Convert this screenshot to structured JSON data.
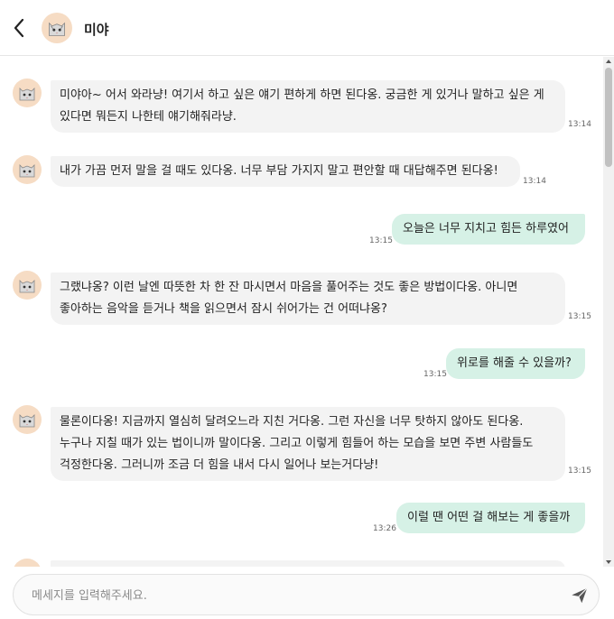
{
  "header": {
    "title": "미야"
  },
  "messages": [
    {
      "from": "bot",
      "text": "미야아~ 어서 와라냥! 여기서 하고 싶은 얘기 편하게 하면 된다옹. 궁금한 게 있거나 말하고 싶은 게 있다면 뭐든지 나한테 얘기해줘라냥.",
      "time": "13:14"
    },
    {
      "from": "bot",
      "text": "내가 가끔 먼저 말을 걸 때도 있다옹. 너무 부담 가지지 말고 편안할 때 대답해주면 된다옹!",
      "time": "13:14"
    },
    {
      "from": "user",
      "text": "오늘은 너무 지치고 힘든 하루였어",
      "time": "13:15"
    },
    {
      "from": "bot",
      "text": "그랬냐옹? 이런 날엔 따뜻한 차 한 잔 마시면서 마음을 풀어주는 것도 좋은 방법이다옹. 아니면 좋아하는 음악을 듣거나 책을 읽으면서 잠시 쉬어가는 건 어떠냐옹?",
      "time": "13:15"
    },
    {
      "from": "user",
      "text": "위로를 해줄 수 있을까?",
      "time": "13:15"
    },
    {
      "from": "bot",
      "text": "물론이다옹! 지금까지 열심히 달려오느라 지친 거다옹. 그런 자신을 너무 탓하지 않아도 된다옹. 누구나 지칠 때가 있는 법이니까 말이다옹. 그리고 이렇게 힘들어 하는 모습을 보면 주변 사람들도 걱정한다옹. 그러니까 조금 더 힘을 내서 다시 일어나 보는거다냥!",
      "time": "13:15"
    },
    {
      "from": "user",
      "text": "이럴 땐 어떤 걸 해보는 게 좋을까",
      "time": "13:26"
    }
  ],
  "composer": {
    "placeholder": "메세지를 입력해주세요."
  },
  "colors": {
    "user_bubble": "#d6f1e6",
    "bot_bubble": "#f3f3f3",
    "avatar_bg": "#f6dcc4"
  },
  "icons": {
    "back": "chevron-left-icon",
    "send": "paper-plane-icon",
    "avatar": "cat-avatar-icon"
  }
}
